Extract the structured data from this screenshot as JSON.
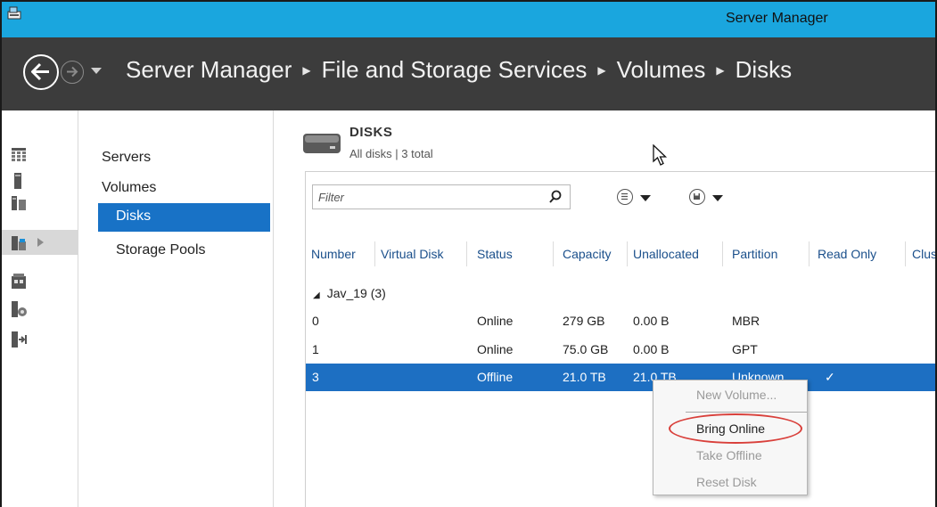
{
  "window": {
    "title": "Server Manager",
    "app_icon": "server-manager-icon"
  },
  "navigation": {
    "back_icon": "back-arrow-icon",
    "forward_icon": "forward-arrow-icon",
    "breadcrumbs": [
      "Server Manager",
      "File and Storage Services",
      "Volumes",
      "Disks"
    ]
  },
  "rail": {
    "items": [
      "dashboard-icon",
      "local-server-icon",
      "all-servers-icon",
      "file-storage-icon",
      "iis-icon",
      "remote-access-icon",
      "rds-icon"
    ],
    "selected_index": 3
  },
  "subnav": {
    "items": [
      {
        "label": "Servers",
        "level": 0
      },
      {
        "label": "Volumes",
        "level": 0
      },
      {
        "label": "Disks",
        "level": 1,
        "selected": true
      },
      {
        "label": "Storage Pools",
        "level": 1
      }
    ]
  },
  "panel": {
    "title": "DISKS",
    "subtitle": "All disks | 3 total",
    "filter_placeholder": "Filter",
    "columns": [
      "Number",
      "Virtual Disk",
      "Status",
      "Capacity",
      "Unallocated",
      "Partition",
      "Read Only",
      "Clus"
    ],
    "group": {
      "label": "Jav_19 (3)",
      "rows": [
        {
          "number": "0",
          "virtual_disk": "",
          "status": "Online",
          "capacity": "279 GB",
          "unallocated": "0.00 B",
          "partition": "MBR",
          "read_only": ""
        },
        {
          "number": "1",
          "virtual_disk": "",
          "status": "Online",
          "capacity": "75.0 GB",
          "unallocated": "0.00 B",
          "partition": "GPT",
          "read_only": ""
        },
        {
          "number": "3",
          "virtual_disk": "",
          "status": "Offline",
          "capacity": "21.0 TB",
          "unallocated": "21.0 TB",
          "partition": "Unknown",
          "read_only": "✓",
          "selected": true
        }
      ]
    }
  },
  "context_menu": {
    "items": [
      {
        "label": "New Volume...",
        "enabled": false
      },
      {
        "label": "Bring Online",
        "enabled": true,
        "highlighted": true
      },
      {
        "label": "Take Offline",
        "enabled": false
      },
      {
        "label": "Reset Disk",
        "enabled": false
      }
    ],
    "highlight_color": "#d9403b"
  },
  "colors": {
    "title_bar": "#1aa6de",
    "nav_bar": "#3c3c3c",
    "selection": "#1d6fc2"
  }
}
